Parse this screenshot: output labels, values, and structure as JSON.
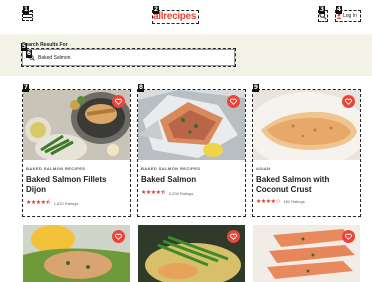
{
  "header": {
    "logo": "allrecipes",
    "login_label": "Log In"
  },
  "search": {
    "heading": "Search Results For",
    "value": "Baked Salmon",
    "placeholder": "Baked Salmon"
  },
  "results": [
    {
      "category": "BAKED SALMON RECIPES",
      "title": "Baked Salmon Fillets Dijon",
      "stars": "★★★★⯪",
      "rating_count": "1,632 Ratings",
      "rating_value": 4.5
    },
    {
      "category": "BAKED SALMON RECIPES",
      "title": "Baked Salmon",
      "stars": "★★★★⯪",
      "rating_count": "3,208 Ratings",
      "rating_value": 4.5
    },
    {
      "category": "ASIAN",
      "title": "Baked Salmon with Coconut Crust",
      "stars": "★★★★☆",
      "rating_count": "182 Ratings",
      "rating_value": 4
    }
  ],
  "annotation_tags": [
    "1",
    "2",
    "3",
    "4",
    "5",
    "6",
    "7",
    "8",
    "9"
  ],
  "colors": {
    "brand": "#e8463a",
    "band": "#f2f3e6",
    "stars": "#d93a2b"
  }
}
